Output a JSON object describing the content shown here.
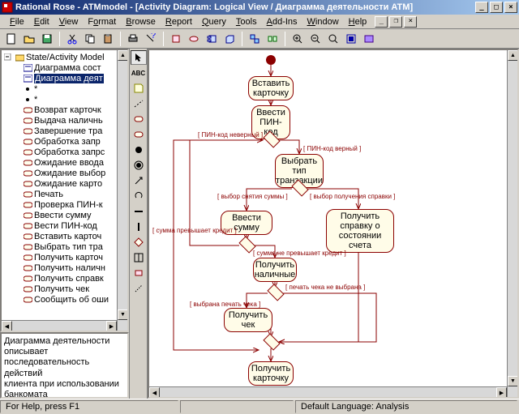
{
  "title": "Rational Rose - ATMmodel - [Activity Diagram: Logical View / Диаграмма деятельности ATM]",
  "menu": {
    "file": "File",
    "edit": "Edit",
    "view": "View",
    "format": "Format",
    "browse": "Browse",
    "report": "Report",
    "query": "Query",
    "tools": "Tools",
    "addins": "Add-Ins",
    "window": "Window",
    "help": "Help"
  },
  "tree": {
    "root": "State/Activity Model",
    "items": [
      "Диаграмма сост",
      "Диаграмма деят",
      "*",
      "*",
      "Возврат карточк",
      "Выдача наличнь",
      "Завершение тра",
      "Обработка запр",
      "Обработка запрс",
      "Ожидание ввода",
      "Ожидание выбор",
      "Ожидание карто",
      "Печать",
      "Проверка ПИН-к",
      "Ввести сумму",
      "Вести ПИН-код",
      "Вставить карточ",
      "Выбрать тип тра",
      "Получить карточ",
      "Получить наличн",
      "Получить справк",
      "Получить чек",
      "Сообщить об оши"
    ],
    "selected_index": 1
  },
  "description": "Диаграмма деятельности\nописывает\nпоследовательность действий\nклиента при использовании\nбанкомата",
  "diagram": {
    "activities": {
      "a1": "Вставить\nкарточку",
      "a2": "Ввести\nПИН-код",
      "a3": "Выбрать тип\nтранзакции",
      "a4": "Ввести сумму",
      "a5": "Получить справку о\nсостоянии счета",
      "a6": "Получить\nналичные",
      "a7": "Получить чек",
      "a8": "Получить\nкарточку"
    },
    "guards": {
      "g1": "[ ПИН-код неверный ]",
      "g2": "[ ПИН-код верный ]",
      "g3": "[ выбор снятия суммы ]",
      "g4": "[ выбор получения справки ]",
      "g5": "[ сумма превышает кредит ]",
      "g6": "[ сумма не превышает кредит ]",
      "g7": "[ печать чека не выбрана ]",
      "g8": "[ выбрана печать чека ]"
    }
  },
  "status": {
    "left": "For Help, press F1",
    "right": "Default Language: Analysis"
  }
}
